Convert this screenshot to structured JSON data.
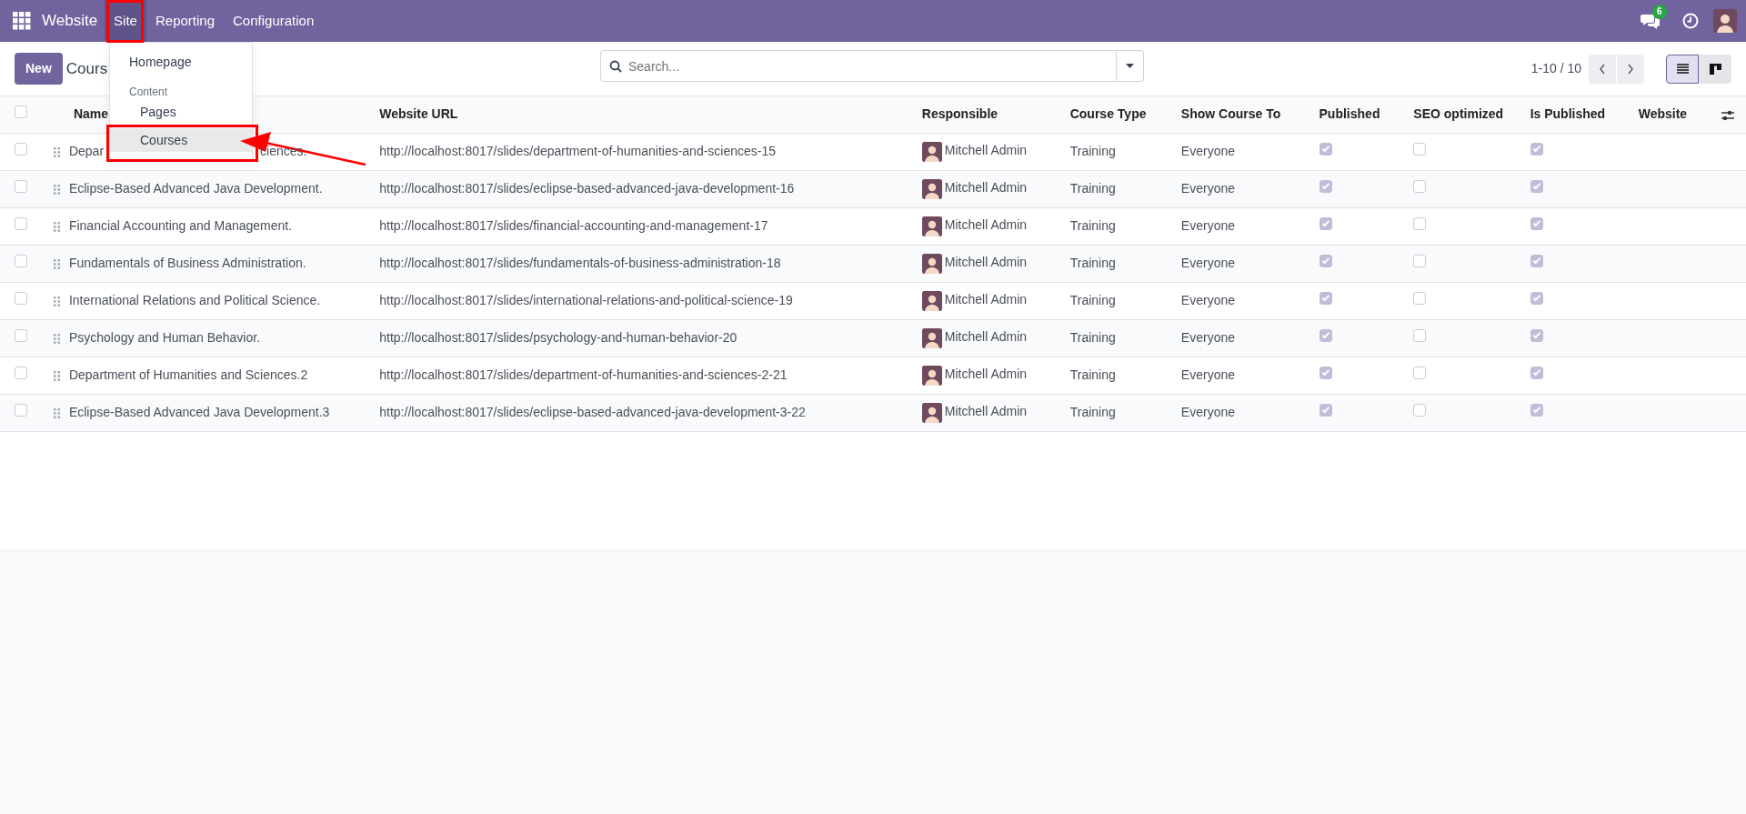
{
  "navbar": {
    "app": "Website",
    "menus": [
      {
        "label": "Site",
        "selected": true
      },
      {
        "label": "Reporting",
        "selected": false
      },
      {
        "label": "Configuration",
        "selected": false
      }
    ],
    "chat_badge": "6"
  },
  "dropdown": {
    "items": [
      {
        "kind": "item",
        "label": "Homepage",
        "selected": false
      },
      {
        "kind": "header",
        "label": "Content"
      },
      {
        "kind": "subitem",
        "label": "Pages",
        "selected": false
      },
      {
        "kind": "subitem",
        "label": "Courses",
        "selected": true
      }
    ]
  },
  "control_panel": {
    "new_button": "New",
    "breadcrumb": "Cours",
    "search": {
      "placeholder": "Search..."
    },
    "pager": "1-10 / 10",
    "views": [
      {
        "kind": "list",
        "selected": true
      },
      {
        "kind": "kanban",
        "selected": false
      }
    ]
  },
  "table": {
    "all_checked": false,
    "columns": [
      "Name",
      "Website URL",
      "Responsible",
      "Course Type",
      "Show Course To",
      "Published",
      "SEO optimized",
      "Is Published",
      "Website"
    ],
    "rows": [
      {
        "name": "Depar",
        "name_tail": "ciences.",
        "url": "http://localhost:8017/slides/department-of-humanities-and-sciences-15",
        "responsible": "Mitchell Admin",
        "course_type": "Training",
        "show_to": "Everyone",
        "published": true,
        "seo_optimized": false,
        "is_published": true,
        "checked": false
      },
      {
        "name": "Eclipse-Based Advanced Java Development.",
        "url": "http://localhost:8017/slides/eclipse-based-advanced-java-development-16",
        "responsible": "Mitchell Admin",
        "course_type": "Training",
        "show_to": "Everyone",
        "published": true,
        "seo_optimized": false,
        "is_published": true,
        "checked": false
      },
      {
        "name": "Financial Accounting and Management.",
        "url": "http://localhost:8017/slides/financial-accounting-and-management-17",
        "responsible": "Mitchell Admin",
        "course_type": "Training",
        "show_to": "Everyone",
        "published": true,
        "seo_optimized": false,
        "is_published": true,
        "checked": false
      },
      {
        "name": "Fundamentals of Business Administration.",
        "url": "http://localhost:8017/slides/fundamentals-of-business-administration-18",
        "responsible": "Mitchell Admin",
        "course_type": "Training",
        "show_to": "Everyone",
        "published": true,
        "seo_optimized": false,
        "is_published": true,
        "checked": false
      },
      {
        "name": "International Relations and Political Science.",
        "url": "http://localhost:8017/slides/international-relations-and-political-science-19",
        "responsible": "Mitchell Admin",
        "course_type": "Training",
        "show_to": "Everyone",
        "published": true,
        "seo_optimized": false,
        "is_published": true,
        "checked": false
      },
      {
        "name": "Psychology and Human Behavior.",
        "url": "http://localhost:8017/slides/psychology-and-human-behavior-20",
        "responsible": "Mitchell Admin",
        "course_type": "Training",
        "show_to": "Everyone",
        "published": true,
        "seo_optimized": false,
        "is_published": true,
        "checked": false
      },
      {
        "name": "Department of Humanities and Sciences.2",
        "url": "http://localhost:8017/slides/department-of-humanities-and-sciences-2-21",
        "responsible": "Mitchell Admin",
        "course_type": "Training",
        "show_to": "Everyone",
        "published": true,
        "seo_optimized": false,
        "is_published": true,
        "checked": false
      },
      {
        "name": "Eclipse-Based Advanced Java Development.3",
        "url": "http://localhost:8017/slides/eclipse-based-advanced-java-development-3-22",
        "responsible": "Mitchell Admin",
        "course_type": "Training",
        "show_to": "Everyone",
        "published": true,
        "seo_optimized": false,
        "is_published": true,
        "checked": false
      }
    ]
  }
}
